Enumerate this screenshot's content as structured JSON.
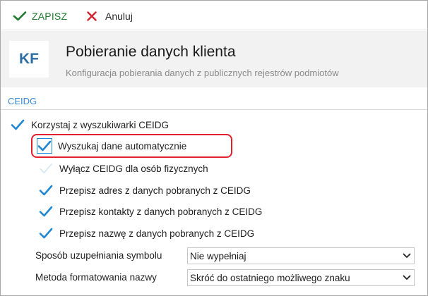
{
  "toolbar": {
    "save_label": "ZAPISZ",
    "cancel_label": "Anuluj",
    "save_icon": "checkmark-icon",
    "cancel_icon": "close-x-icon",
    "save_color": "#1e7a2c",
    "cancel_icon_color": "#d3232f"
  },
  "header": {
    "badge": "KF",
    "title": "Pobieranie danych klienta",
    "subtitle": "Konfiguracja pobierania danych z publicznych rejestrów podmiotów"
  },
  "section": {
    "label": "CEIDG",
    "accent": "#3c8cd6"
  },
  "options": {
    "use_search": {
      "label": "Korzystaj z wyszukiwarki CEIDG",
      "checked": true
    },
    "auto_search": {
      "label": "Wyszukaj dane automatycznie",
      "checked": true,
      "highlighted": true
    },
    "disable_persons": {
      "label": "Wyłącz CEIDG dla osób fizycznych",
      "checked": false
    },
    "copy_address": {
      "label": "Przepisz adres z danych pobranych z CEIDG",
      "checked": true
    },
    "copy_contacts": {
      "label": "Przepisz kontakty z danych pobranych z CEIDG",
      "checked": true
    },
    "copy_name": {
      "label": "Przepisz nazwę z danych pobranych z CEIDG",
      "checked": true
    }
  },
  "selects": {
    "symbol": {
      "label": "Sposób uzupełniania symbolu",
      "value": "Nie wypełniaj"
    },
    "name_format": {
      "label": "Metoda formatowania nazwy",
      "value": "Skróć do ostatniego możliwego znaku"
    }
  },
  "colors": {
    "check": "#1e88d2",
    "highlight_border": "#e31e2d"
  }
}
